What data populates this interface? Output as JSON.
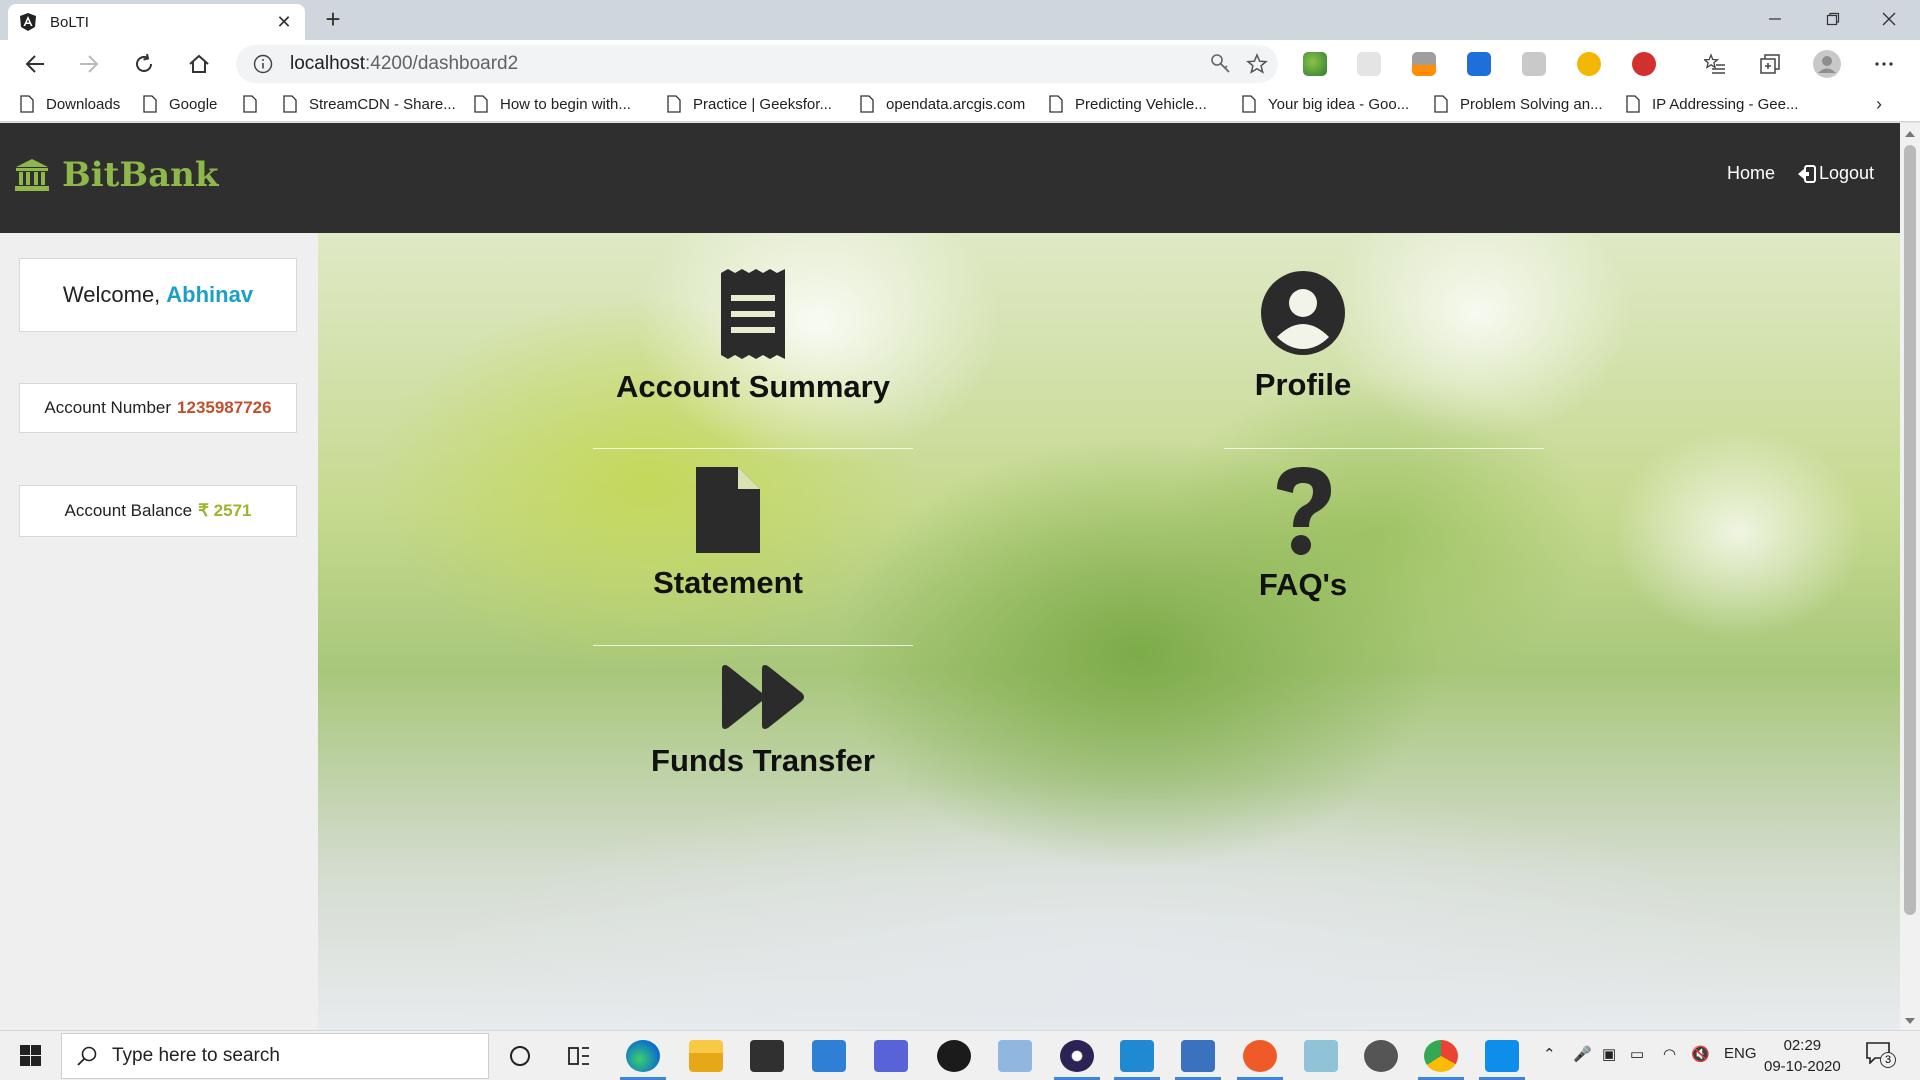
{
  "browser": {
    "tab_title": "BoLTI",
    "url_host": "localhost",
    "url_path": ":4200/dashboard2",
    "bookmarks": [
      "Downloads",
      "Google",
      "",
      "StreamCDN - Share...",
      "How to begin with...",
      "Practice | Geeksfor...",
      "opendata.arcgis.com",
      "Predicting Vehicle...",
      "Your big idea - Goo...",
      "Problem Solving an...",
      "IP Addressing - Gee..."
    ]
  },
  "app": {
    "brand": "BitBank",
    "brand_color": "#8fb84a",
    "nav": {
      "home": "Home",
      "logout": "Logout"
    },
    "sidebar": {
      "welcome_label": "Welcome,",
      "user_name": "Abhinav",
      "account_number_label": "Account Number",
      "account_number": "1235987726",
      "account_balance_label": "Account Balance",
      "currency_symbol": "₹",
      "account_balance": "2571"
    },
    "tiles": [
      {
        "label": "Account Summary",
        "icon": "receipt-icon"
      },
      {
        "label": "Profile",
        "icon": "user-circle-icon"
      },
      {
        "label": "Statement",
        "icon": "file-icon"
      },
      {
        "label": "FAQ's",
        "icon": "question-icon"
      },
      {
        "label": "Funds Transfer",
        "icon": "fast-forward-icon"
      }
    ]
  },
  "taskbar": {
    "search_placeholder": "Type here to search",
    "language": "ENG",
    "time": "02:29",
    "date": "09-10-2020",
    "notification_count": "3"
  }
}
